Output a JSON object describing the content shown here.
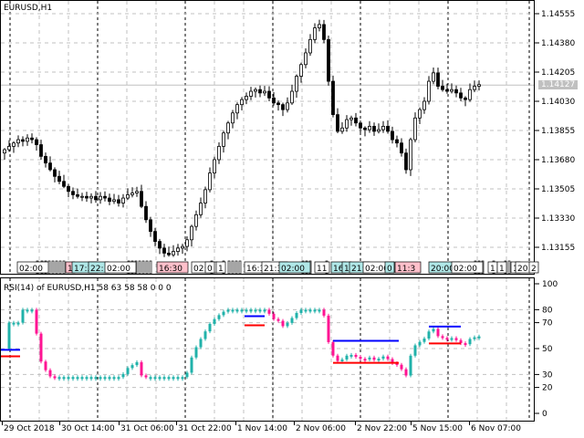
{
  "chart": {
    "symbol_label": "EURUSD,H1",
    "current_price": "1.14127",
    "price_ticks": [
      "1.14555",
      "1.14380",
      "1.14205",
      "1.14030",
      "1.13855",
      "1.13680",
      "1.13505",
      "1.13330",
      "1.13155"
    ],
    "price_tick_values": [
      1.14555,
      1.1438,
      1.14205,
      1.1403,
      1.13855,
      1.1368,
      1.13505,
      1.1333,
      1.13155
    ],
    "closes": [
      1.1374,
      1.1376,
      1.1378,
      1.138,
      1.1379,
      1.1381,
      1.138,
      1.1377,
      1.137,
      1.1366,
      1.1362,
      1.1358,
      1.1355,
      1.1352,
      1.1349,
      1.1347,
      1.1346,
      1.1346,
      1.1345,
      1.1346,
      1.1344,
      1.1346,
      1.1345,
      1.1343,
      1.1344,
      1.1342,
      1.1345,
      1.1347,
      1.1348,
      1.1349,
      1.134,
      1.1332,
      1.1325,
      1.1319,
      1.1315,
      1.1312,
      1.1311,
      1.1313,
      1.1315,
      1.1316,
      1.132,
      1.1328,
      1.1335,
      1.1342,
      1.135,
      1.136,
      1.1368,
      1.1376,
      1.1384,
      1.139,
      1.1396,
      1.1401,
      1.1404,
      1.1406,
      1.1409,
      1.141,
      1.1408,
      1.1409,
      1.1405,
      1.1402,
      1.1401,
      1.1398,
      1.1402,
      1.1409,
      1.1418,
      1.1425,
      1.1432,
      1.144,
      1.1447,
      1.1449,
      1.144,
      1.1415,
      1.1395,
      1.1385,
      1.1387,
      1.1392,
      1.1393,
      1.139,
      1.1387,
      1.1386,
      1.1388,
      1.1385,
      1.1386,
      1.1388,
      1.1385,
      1.138,
      1.1378,
      1.1372,
      1.1362,
      1.138,
      1.1393,
      1.1398,
      1.1403,
      1.1415,
      1.142,
      1.1412,
      1.141,
      1.1409,
      1.141,
      1.1408,
      1.1405,
      1.1404,
      1.141,
      1.1412,
      1.1413
    ],
    "session_labels": [
      {
        "text": "02:00",
        "kind": "white"
      },
      {
        "text": "1",
        "kind": "pink"
      },
      {
        "text": "17:3",
        "kind": "cyan"
      },
      {
        "text": "22:",
        "kind": "cyan"
      },
      {
        "text": "02:00",
        "kind": "white"
      },
      {
        "text": "16:30",
        "kind": "pink"
      },
      {
        "text": "02:0",
        "kind": "white"
      },
      {
        "text": "0",
        "kind": "white"
      },
      {
        "text": "1",
        "kind": "white"
      },
      {
        "text": "16:3",
        "kind": "white"
      },
      {
        "text": "21:3",
        "kind": "white"
      },
      {
        "text": "02:00",
        "kind": "cyan"
      },
      {
        "text": "11",
        "kind": "white"
      },
      {
        "text": "16",
        "kind": "cyan"
      },
      {
        "text": "1",
        "kind": "cyan"
      },
      {
        "text": "21:",
        "kind": "cyan"
      },
      {
        "text": "02:00",
        "kind": "white"
      },
      {
        "text": "0",
        "kind": "cyan"
      },
      {
        "text": "11:3",
        "kind": "pink"
      },
      {
        "text": "20:00",
        "kind": "cyan"
      },
      {
        "text": "02:00",
        "kind": "white"
      },
      {
        "text": "1",
        "kind": "white"
      },
      {
        "text": "1",
        "kind": "white"
      },
      {
        "text": "1",
        "kind": "white"
      },
      {
        "text": "20",
        "kind": "white"
      },
      {
        "text": "2",
        "kind": "white"
      }
    ]
  },
  "rsi": {
    "label": "RSI(14) of EURUSD,H1 58 63 58 58 0 0 0",
    "period": 14,
    "ticks": [
      "100",
      "80",
      "70",
      "50",
      "30",
      "20",
      "0"
    ],
    "tick_values": [
      100,
      80,
      70,
      50,
      30,
      20,
      0
    ],
    "levels": [
      {
        "blue": 49,
        "red": 44
      },
      {
        "blue": 75,
        "red": 68
      },
      {
        "blue": 56,
        "red": 39
      },
      {
        "blue": 67,
        "red": 54
      }
    ]
  },
  "time_axis": [
    "29 Oct 2018",
    "30 Oct 14:00",
    "31 Oct 06:00",
    "31 Oct 22:00",
    "1 Nov 14:00",
    "2 Nov 06:00",
    "2 Nov 22:00",
    "5 Nov 15:00",
    "6 Nov 07:00"
  ],
  "colors": {
    "up": "#20b2aa",
    "down": "#ff1493",
    "blue": "#0000ff",
    "red": "#ff0000",
    "pink": "#ffc0cb",
    "cyan": "#b0e8e8",
    "price_tag": "#c0c0c0"
  }
}
